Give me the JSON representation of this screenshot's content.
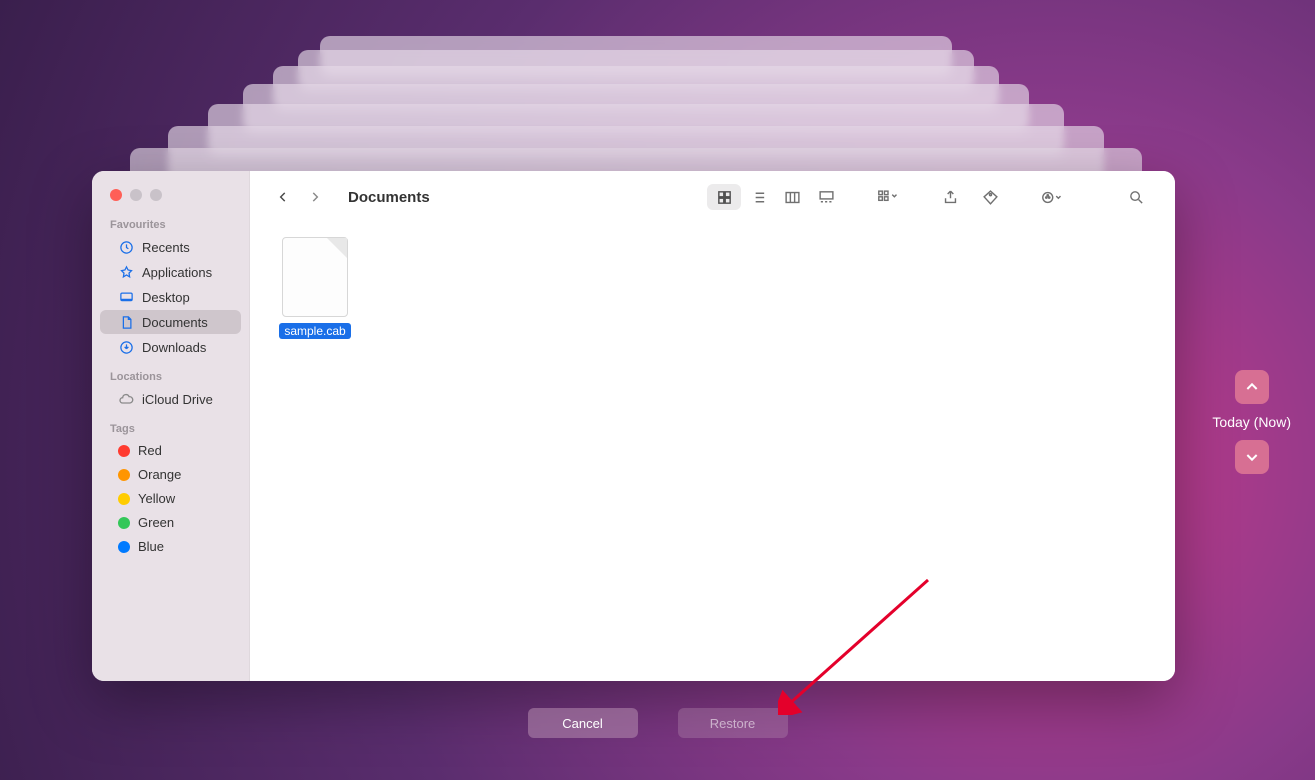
{
  "window": {
    "title": "Documents"
  },
  "sidebar": {
    "sections": {
      "favourites": {
        "title": "Favourites",
        "items": [
          {
            "label": "Recents"
          },
          {
            "label": "Applications"
          },
          {
            "label": "Desktop"
          },
          {
            "label": "Documents"
          },
          {
            "label": "Downloads"
          }
        ]
      },
      "locations": {
        "title": "Locations",
        "items": [
          {
            "label": "iCloud Drive"
          }
        ]
      },
      "tags": {
        "title": "Tags",
        "items": [
          {
            "label": "Red",
            "color": "#ff3b30"
          },
          {
            "label": "Orange",
            "color": "#ff9500"
          },
          {
            "label": "Yellow",
            "color": "#ffcc00"
          },
          {
            "label": "Green",
            "color": "#34c759"
          },
          {
            "label": "Blue",
            "color": "#007aff"
          }
        ]
      }
    }
  },
  "files": [
    {
      "name": "sample.cab",
      "selected": true
    }
  ],
  "timeline": {
    "label": "Today (Now)"
  },
  "buttons": {
    "cancel": "Cancel",
    "restore": "Restore"
  }
}
